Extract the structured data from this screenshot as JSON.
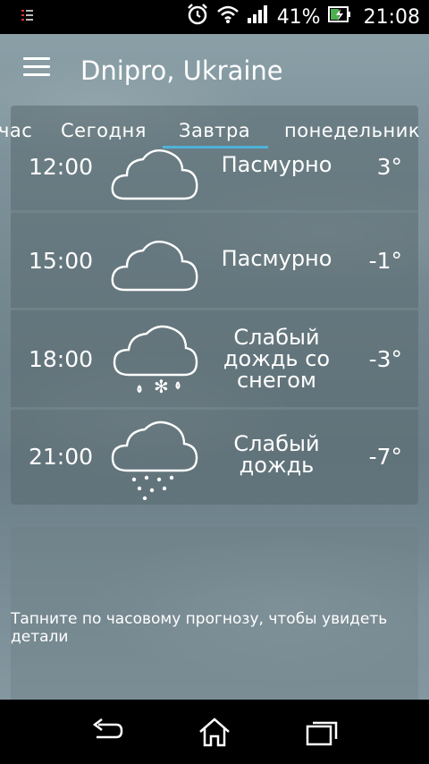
{
  "status_bar": {
    "battery_percent": "41%",
    "time": "21:08",
    "icons": [
      "notification-icon",
      "alarm-icon",
      "wifi-icon",
      "signal-icon",
      "battery-charging-icon"
    ]
  },
  "app_bar": {
    "menu_icon": "menu-icon",
    "location": "Dnipro, Ukraine"
  },
  "tabs": [
    {
      "label": "час"
    },
    {
      "label": "Сегодня"
    },
    {
      "label": "Завтра",
      "active": true
    },
    {
      "label": "понедельник"
    }
  ],
  "forecast": [
    {
      "time": "12:00",
      "icon": "cloudy-icon",
      "condition": "Пасмурно",
      "temp": "3°"
    },
    {
      "time": "15:00",
      "icon": "cloudy-icon",
      "condition": "Пасмурно",
      "temp": "-1°"
    },
    {
      "time": "18:00",
      "icon": "rain-snow-icon",
      "condition": "Слабый дождь со снегом",
      "condition_lines": [
        "Слабый",
        "дождь со",
        "снегом"
      ],
      "temp": "-3°"
    },
    {
      "time": "21:00",
      "icon": "light-rain-icon",
      "condition": "Слабый дождь",
      "condition_lines": [
        "Слабый",
        "дождь"
      ],
      "temp": "-7°"
    }
  ],
  "hint": {
    "text": "Тапните по часовому прогнозу, чтобы увидеть детали"
  },
  "nav_bar": {
    "icons": [
      "back-icon",
      "home-icon",
      "recent-apps-icon"
    ]
  },
  "colors": {
    "tab_indicator": "#4fb3d9",
    "status_bar_bg": "#000000"
  }
}
